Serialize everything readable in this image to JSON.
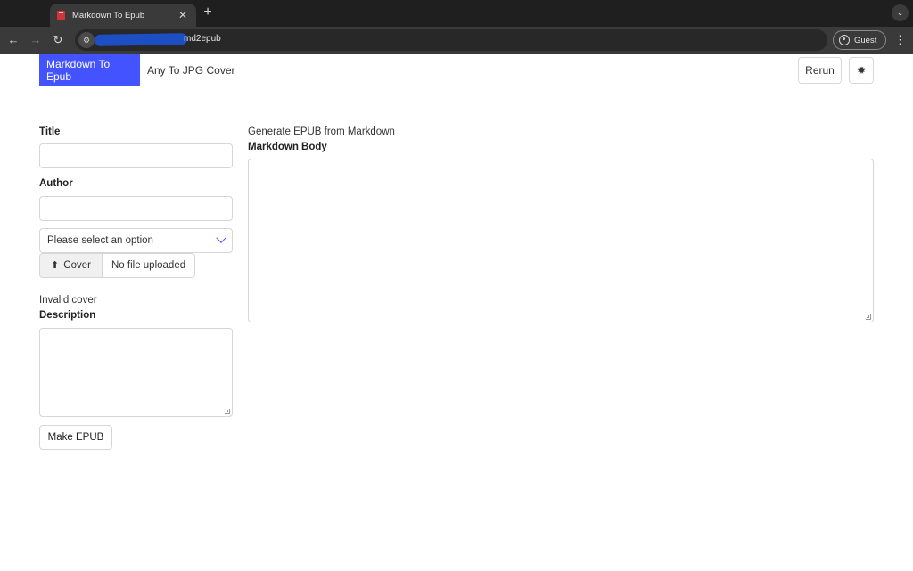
{
  "browser": {
    "tab_title": "Markdown To Epub",
    "new_tab": "+",
    "url_visible": "md2epub",
    "profile_label": "Guest"
  },
  "app": {
    "tabs": [
      {
        "label": "Markdown To Epub",
        "active": true
      },
      {
        "label": "Any To JPG Cover",
        "active": false
      }
    ],
    "rerun_label": "Rerun",
    "settings_icon": "gear-icon",
    "accent_color": "#4253ff"
  },
  "form": {
    "title_label": "Title",
    "title_value": "",
    "author_label": "Author",
    "author_value": "",
    "select_placeholder": "Please select an option",
    "cover_button_label": "Cover",
    "cover_file_status": "No file uploaded",
    "cover_error": "Invalid cover",
    "description_label": "Description",
    "description_value": "",
    "make_button_label": "Make EPUB"
  },
  "body": {
    "heading": "Generate EPUB from Markdown",
    "markdown_label": "Markdown Body",
    "markdown_value": ""
  }
}
